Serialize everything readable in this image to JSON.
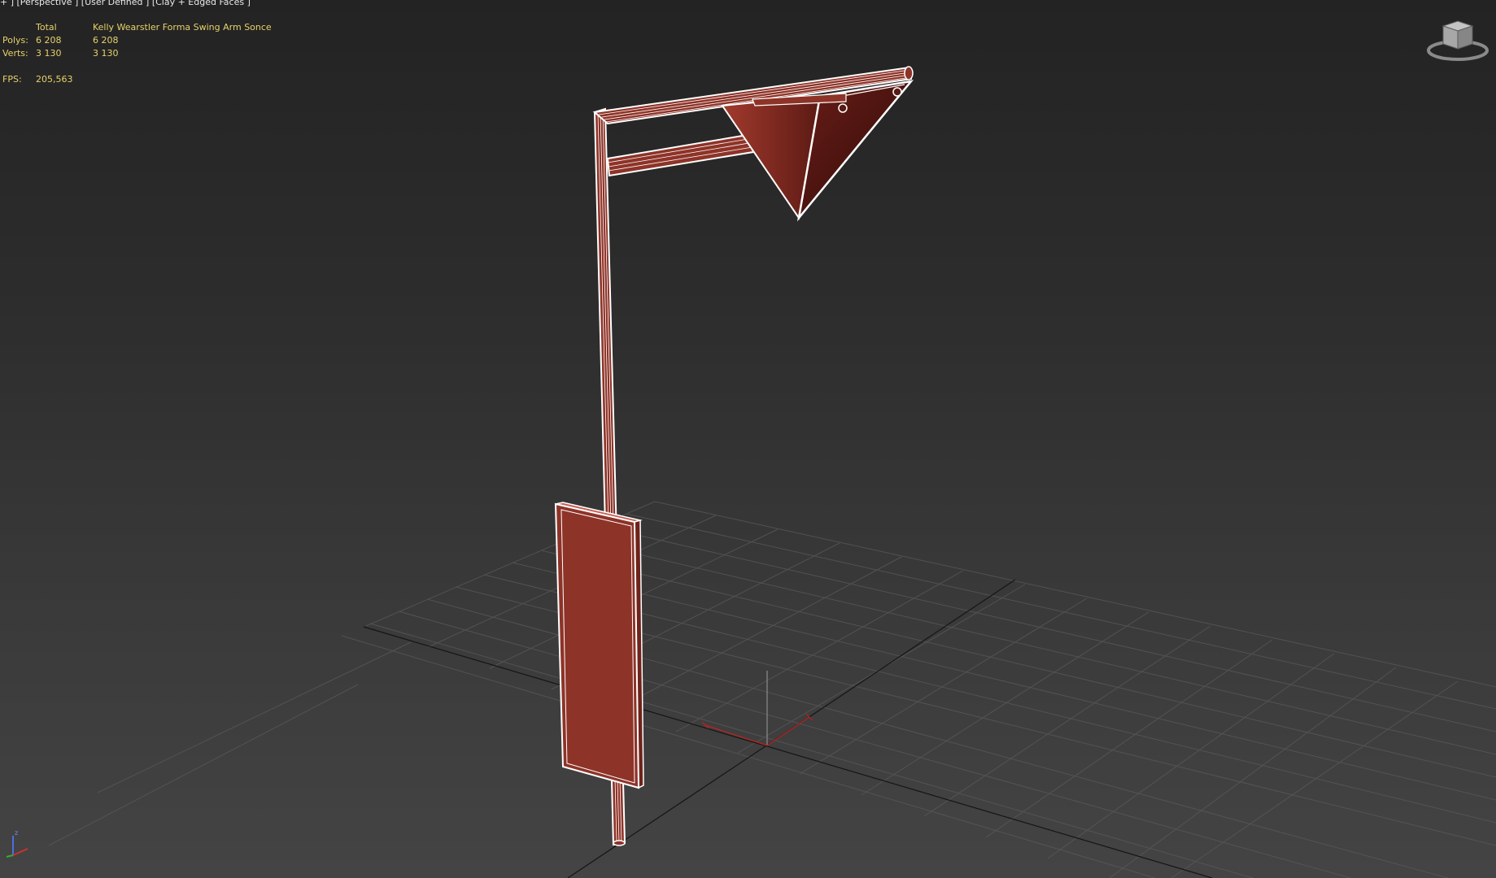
{
  "viewport": {
    "label": "+ ] [Perspective ] [User Defined ] [Clay + Edged Faces ]"
  },
  "stats": {
    "header_total": "Total",
    "header_object": "Kelly Wearstler Forma Swing Arm Sonce",
    "polys_label": "Polys:",
    "polys_total": "6 208",
    "polys_object": "6 208",
    "verts_label": "Verts:",
    "verts_total": "3 130",
    "verts_object": "3 130",
    "fps_label": "FPS:",
    "fps_value": "205,563"
  },
  "gizmo": {
    "axis_z": "z"
  },
  "colors": {
    "clay": "#8e3328",
    "wire": "#ffffff",
    "stats_text": "#e6d26a",
    "grid": "#5a5a5a",
    "axis_line": "#111111",
    "pivot_x": "#cc2222"
  },
  "icons": {
    "viewcube": "viewcube-icon",
    "axis_gizmo": "xyz-axis-icon"
  }
}
